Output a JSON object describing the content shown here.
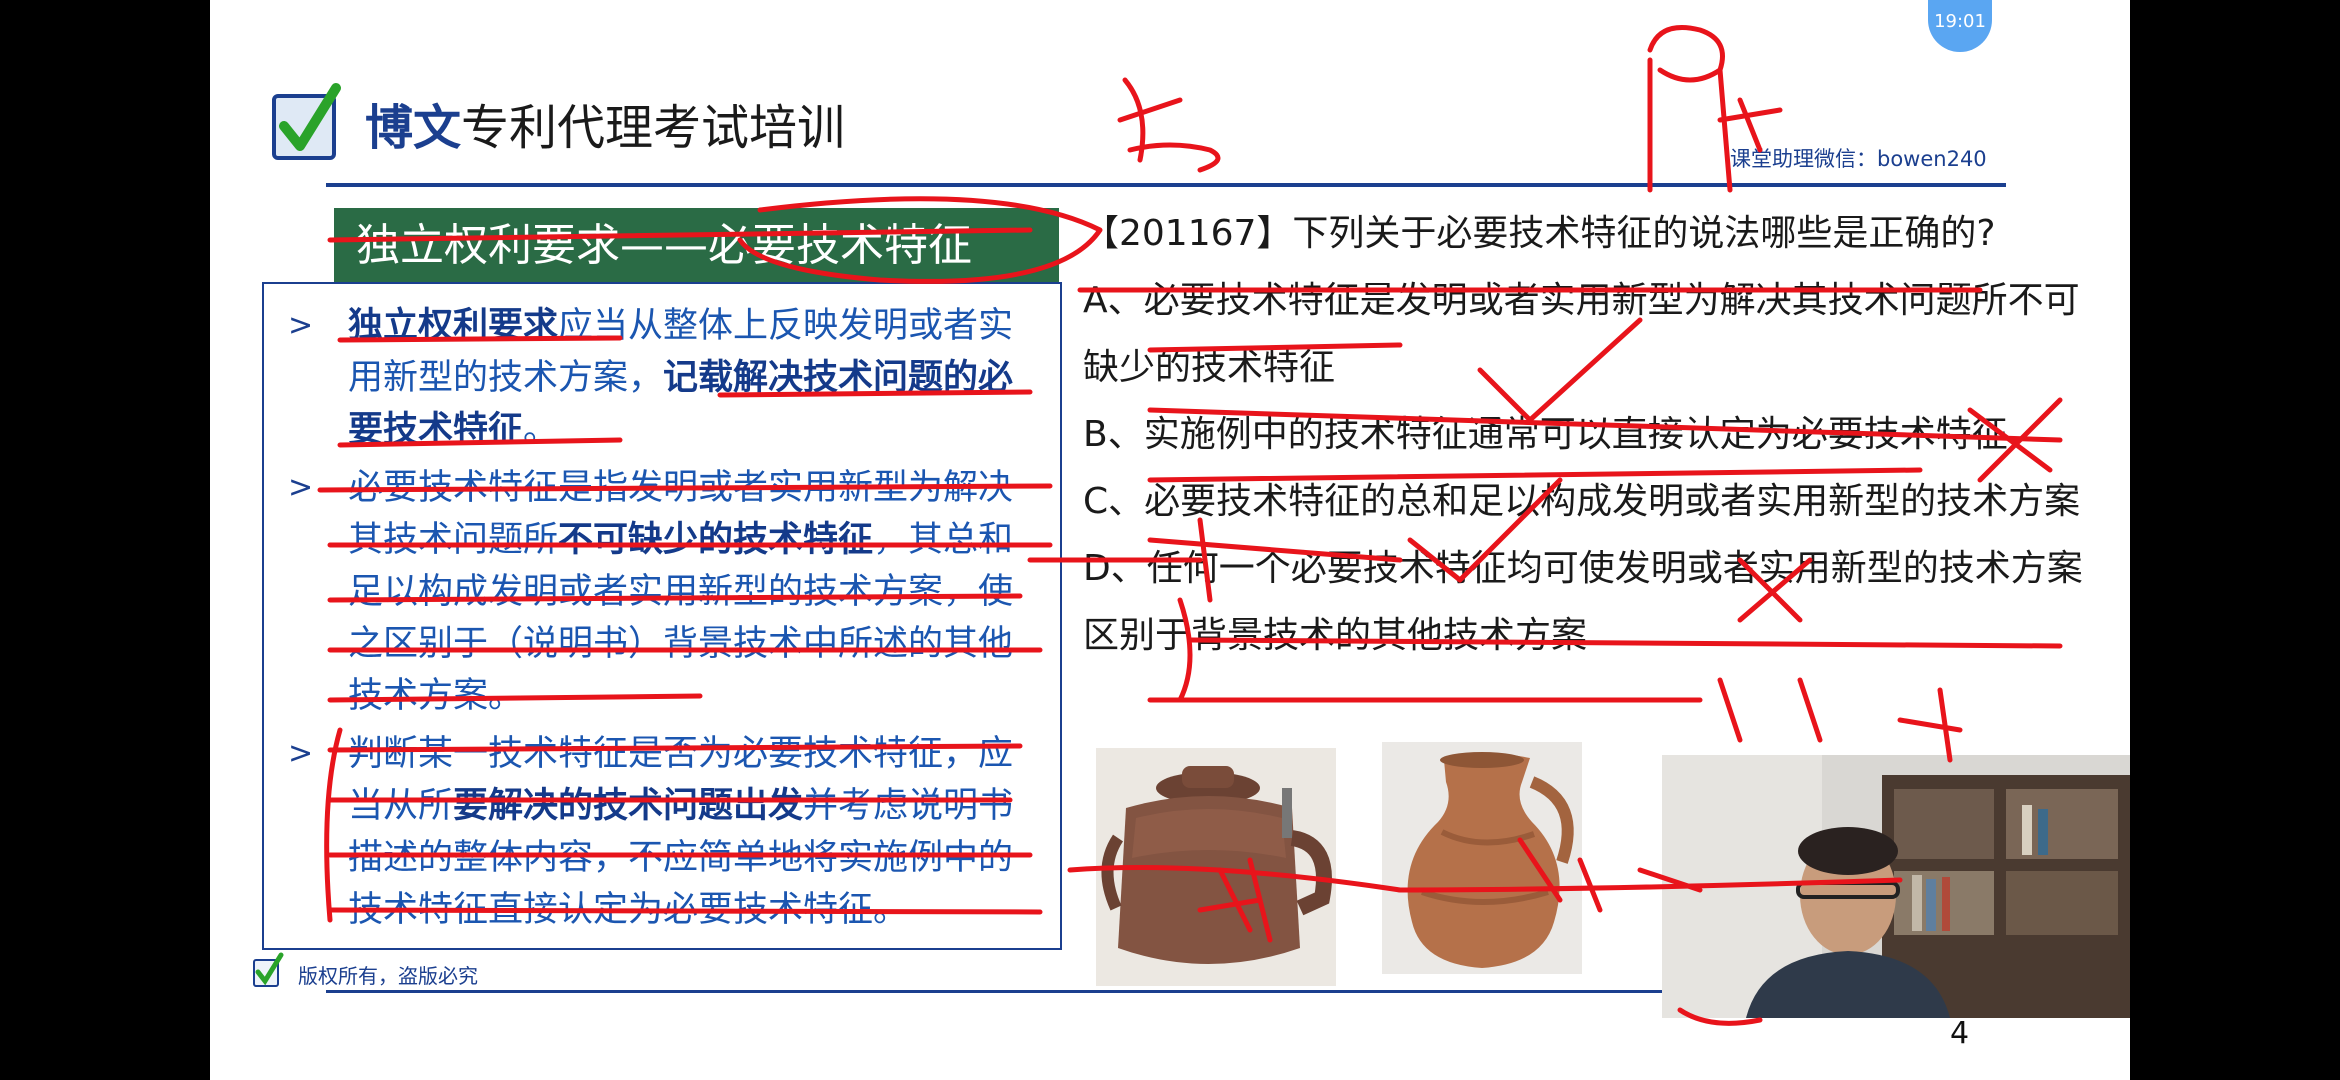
{
  "header": {
    "brand": "博文",
    "title_rest": "专利代理考试培训",
    "assistant_note": "课堂助理微信：bowen240",
    "clock": "19:01"
  },
  "left": {
    "banner": "独立权利要求——必要技术特征",
    "points": [
      {
        "parts": [
          {
            "text": "独立权利要求",
            "bold": true
          },
          {
            "text": "应当从整体上反映发明或者实用新型的技术方案，",
            "bold": false
          },
          {
            "text": "记载解决技术问题的必要技术特征",
            "bold": true
          },
          {
            "text": "。",
            "bold": false
          }
        ]
      },
      {
        "parts": [
          {
            "text": "必要技术特征是指发明或者实用新型为解决其技术问题所",
            "bold": false
          },
          {
            "text": "不可缺少的技术特征",
            "bold": true
          },
          {
            "text": "，其总和足以构成发明或者实用新型的技术方案，使之区别于（说明书）背景技术中所述的其他技术方案。",
            "bold": false
          }
        ]
      },
      {
        "parts": [
          {
            "text": "判断某一技术特征是否为必要技术特征，应当从所",
            "bold": false
          },
          {
            "text": "要解决的技术问题出发",
            "bold": true
          },
          {
            "text": "并考虑说明书描述的整体内容，不应简单地将实施例中的技术特征直接认定为必要技术特征。",
            "bold": false
          }
        ]
      }
    ]
  },
  "question": {
    "stem": "【201167】下列关于必要技术特征的说法哪些是正确的?",
    "options": [
      "A、必要技术特征是发明或者实用新型为解决其技术问题所不可缺少的技术特征",
      "B、实施例中的技术特征通常可以直接认定为必要技术特征",
      "C、必要技术特征的总和足以构成发明或者实用新型的技术方案",
      "D、任何一个必要技术特征均可使发明或者实用新型的技术方案区别于背景技术的其他技术方案"
    ]
  },
  "footer": {
    "copyright": "版权所有，盗版必究",
    "page_number": "4"
  },
  "colors": {
    "brand_blue": "#1b3f8f",
    "banner_green": "#2a6b45",
    "ink_red": "#e8141b"
  },
  "icons": {
    "logo": "checkbox-check-icon",
    "copyright": "checkbox-check-icon"
  }
}
